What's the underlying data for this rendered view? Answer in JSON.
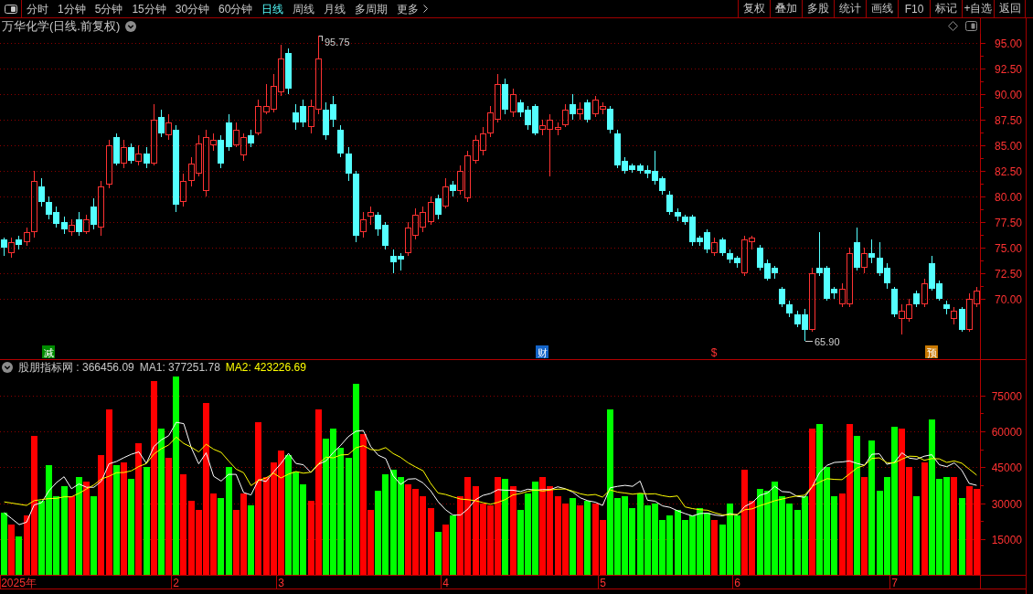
{
  "toolbar": {
    "periods": [
      {
        "label": "分时",
        "kind": "period",
        "selected": false
      },
      {
        "label": "1分钟",
        "kind": "period",
        "selected": false
      },
      {
        "label": "5分钟",
        "kind": "period",
        "selected": false
      },
      {
        "label": "15分钟",
        "kind": "period",
        "selected": false
      },
      {
        "label": "30分钟",
        "kind": "period",
        "selected": false
      },
      {
        "label": "60分钟",
        "kind": "period",
        "selected": false
      },
      {
        "label": "日线",
        "kind": "period",
        "selected": true
      },
      {
        "label": "周线",
        "kind": "period",
        "selected": false
      },
      {
        "label": "月线",
        "kind": "period",
        "selected": false
      },
      {
        "label": "多周期",
        "kind": "period",
        "selected": false
      },
      {
        "label": "更多",
        "kind": "more",
        "selected": false
      }
    ],
    "actions": [
      "复权",
      "叠加",
      "多股",
      "统计",
      "画线",
      "F10",
      "标记",
      "+自选",
      "返回"
    ]
  },
  "chart": {
    "readouts": [
      {
        "text": "股朋指标网 : 366456.09",
        "color": "#c8c8c8"
      },
      {
        "text": "MA1: 377251.78",
        "color": "#c8c8c8"
      },
      {
        "text": "MA2: 423226.69",
        "color": "#ffff00"
      }
    ],
    "event_markers": [
      {
        "kind": "badge",
        "color": "#008c00"
      },
      {
        "kind": "badge",
        "color": "#1464c8"
      },
      {
        "kind": "glyph",
        "color": "#ff3232"
      },
      {
        "kind": "badge",
        "color": "#c87800"
      }
    ],
    "chart_data": [
      {
        "type": "candlestick",
        "title": "万华化学(日线.前复权)",
        "categories": [
          null,
          null,
          null,
          null,
          null,
          null,
          "减",
          null,
          null,
          null,
          null,
          null,
          null,
          null,
          null,
          null,
          null,
          null,
          null,
          null,
          null,
          null,
          null,
          null,
          null,
          null,
          null,
          null,
          null,
          null,
          null,
          null,
          null,
          null,
          null,
          null,
          null,
          null,
          null,
          null,
          null,
          null,
          null,
          null,
          null,
          null,
          null,
          null,
          null,
          null,
          null,
          null,
          null,
          null,
          null,
          null,
          null,
          null,
          null,
          null,
          null,
          null,
          null,
          null,
          null,
          null,
          null,
          null,
          null,
          null,
          null,
          null,
          "财",
          null,
          null,
          null,
          null,
          null,
          null,
          null,
          null,
          null,
          null,
          null,
          null,
          null,
          null,
          null,
          null,
          null,
          null,
          null,
          null,
          null,
          null,
          "$",
          null,
          null,
          null,
          null,
          null,
          null,
          null,
          null,
          null,
          null,
          null,
          null,
          null,
          null,
          null,
          null,
          null,
          null,
          null,
          null,
          null,
          null,
          null,
          null,
          null,
          null,
          null,
          null,
          "预",
          null,
          null,
          null,
          null,
          null,
          null
        ],
        "ylim": [
          64.1,
          95.9
        ],
        "yticks": [
          {
            "value": 70,
            "label": "70.00"
          },
          {
            "value": 72.5,
            "label": "72.50"
          },
          {
            "value": 75,
            "label": "75.00"
          },
          {
            "value": 77.5,
            "label": "77.50"
          },
          {
            "value": 80,
            "label": "80.00"
          },
          {
            "value": 82.5,
            "label": "82.50"
          },
          {
            "value": 85,
            "label": "85.00"
          },
          {
            "value": 87.5,
            "label": "87.50"
          },
          {
            "value": 90,
            "label": "90.00"
          },
          {
            "value": 92.5,
            "label": "92.50"
          },
          {
            "value": 95,
            "label": "95.00"
          }
        ],
        "grid": true,
        "ohlc": [
          [
            75.8,
            76,
            74.2,
            75
          ],
          [
            74.5,
            76,
            74,
            75.5
          ],
          [
            75.8,
            76.2,
            74.8,
            75.3
          ],
          [
            75.5,
            77,
            75.2,
            76.5
          ],
          [
            76.5,
            82.5,
            76,
            81.5
          ],
          [
            81,
            81.8,
            79,
            79.5
          ],
          [
            79.5,
            80,
            77.8,
            78.2
          ],
          [
            78.5,
            79,
            77,
            77.3
          ],
          [
            77.5,
            78,
            76.3,
            76.8
          ],
          [
            76.5,
            77.8,
            76.2,
            77.2
          ],
          [
            77.8,
            78.5,
            76.2,
            76.5
          ],
          [
            76.5,
            78.2,
            76.3,
            77.8
          ],
          [
            79,
            79.8,
            76.8,
            77.2
          ],
          [
            77,
            81.5,
            76.2,
            81
          ],
          [
            81.2,
            85.5,
            80.8,
            85
          ],
          [
            85.8,
            86.2,
            83,
            83.2
          ],
          [
            83.2,
            85.5,
            82.8,
            84.8
          ],
          [
            84.8,
            85.2,
            83.2,
            83.5
          ],
          [
            83.4,
            85,
            83,
            84.2
          ],
          [
            84.2,
            84.8,
            82.8,
            83.2
          ],
          [
            83.2,
            89,
            83,
            87.5
          ],
          [
            87.8,
            88.5,
            85.8,
            86.2
          ],
          [
            86,
            88,
            85.5,
            87.2
          ],
          [
            86.5,
            87,
            78.5,
            79.2
          ],
          [
            79.5,
            82.2,
            79,
            81.5
          ],
          [
            81.5,
            83.8,
            81,
            83.2
          ],
          [
            82.2,
            86,
            82,
            85.2
          ],
          [
            80.5,
            86.5,
            80,
            85.8
          ],
          [
            85,
            86.2,
            84.5,
            85.5
          ],
          [
            85.5,
            86,
            82.8,
            83.2
          ],
          [
            87.2,
            88,
            84.5,
            84.8
          ],
          [
            85,
            87.2,
            84.8,
            86.5
          ],
          [
            84,
            86.2,
            83.5,
            85.8
          ],
          [
            86,
            86.5,
            84.8,
            85.2
          ],
          [
            86.2,
            89.5,
            86,
            88.8
          ],
          [
            88.2,
            91,
            88,
            88.8
          ],
          [
            88.5,
            92,
            88.2,
            90.8
          ],
          [
            90.2,
            94.8,
            89.8,
            93.5
          ],
          [
            94,
            94.5,
            90,
            90.5
          ],
          [
            88.2,
            89,
            86.5,
            87.2
          ],
          [
            88.8,
            89.5,
            86.8,
            87.2
          ],
          [
            86.8,
            89.5,
            86.2,
            88.8
          ],
          [
            88.5,
            95.75,
            88,
            93.5
          ],
          [
            88.5,
            89.2,
            85.5,
            86
          ],
          [
            89,
            89.8,
            86.8,
            87.5
          ],
          [
            86.5,
            87,
            83.8,
            84.2
          ],
          [
            84.2,
            84.8,
            81.5,
            82.2
          ],
          [
            82.2,
            82.5,
            75.5,
            76.2
          ],
          [
            76.5,
            78.5,
            76,
            77.8
          ],
          [
            78,
            79,
            77.2,
            78.5
          ],
          [
            78.2,
            78.5,
            76.2,
            76.8
          ],
          [
            77.2,
            77.5,
            74.8,
            75.2
          ],
          [
            74.2,
            74.8,
            72.5,
            73.6
          ],
          [
            74.2,
            74.5,
            72.8,
            73.8
          ],
          [
            74.5,
            77.5,
            74.2,
            77
          ],
          [
            76.2,
            78.8,
            75.8,
            78.2
          ],
          [
            77,
            79,
            76.5,
            78.5
          ],
          [
            77.5,
            80,
            77.2,
            79.5
          ],
          [
            79.8,
            80.2,
            77.8,
            78.2
          ],
          [
            79,
            81.8,
            78.8,
            81
          ],
          [
            81.2,
            81.5,
            80,
            80.5
          ],
          [
            80.5,
            83,
            80.2,
            82.5
          ],
          [
            79.8,
            84.5,
            79.5,
            84
          ],
          [
            83.5,
            86,
            83.2,
            85.5
          ],
          [
            84.5,
            86.8,
            84,
            86.2
          ],
          [
            86.2,
            88.8,
            85.8,
            88.2
          ],
          [
            87.5,
            92,
            87.2,
            91
          ],
          [
            91,
            91.5,
            88,
            88.5
          ],
          [
            88.2,
            90.5,
            87.8,
            90
          ],
          [
            89.2,
            89.5,
            87.8,
            88.2
          ],
          [
            88.5,
            88.8,
            86.5,
            87
          ],
          [
            88.8,
            89,
            86,
            86.2
          ],
          [
            86.5,
            87.5,
            86,
            87
          ],
          [
            86.5,
            88,
            82,
            87.5
          ],
          [
            86.5,
            87.2,
            86,
            86.8
          ],
          [
            87,
            89,
            86.8,
            88.5
          ],
          [
            89,
            90,
            87.5,
            88
          ],
          [
            88,
            89.2,
            87.5,
            88.6
          ],
          [
            89.2,
            89.5,
            87.2,
            87.5
          ],
          [
            88,
            89.8,
            87.8,
            89.5
          ],
          [
            88.5,
            89.2,
            88,
            88.8
          ],
          [
            88.6,
            88.8,
            86.2,
            86.5
          ],
          [
            86.2,
            86.5,
            82.8,
            83
          ],
          [
            83.5,
            83.8,
            82.2,
            82.5
          ],
          [
            83,
            83.2,
            82.3,
            82.6
          ],
          [
            83,
            83.2,
            82.2,
            82.5
          ],
          [
            82.6,
            83,
            81.8,
            82.2
          ],
          [
            82.5,
            84.5,
            81.2,
            81.5
          ],
          [
            81.8,
            82,
            80.2,
            80.5
          ],
          [
            80.2,
            80.5,
            78.2,
            78.5
          ],
          [
            78.5,
            78.8,
            77.6,
            78
          ],
          [
            78,
            78.2,
            77.2,
            77.5
          ],
          [
            78,
            78.2,
            75.2,
            75.5
          ],
          [
            76,
            76.2,
            75.2,
            75.5
          ],
          [
            76.5,
            76.8,
            74.5,
            74.8
          ],
          [
            74.5,
            76,
            74.2,
            75.5
          ],
          [
            75.8,
            76,
            74.2,
            74.5
          ],
          [
            74.5,
            74.8,
            73.5,
            73.8
          ],
          [
            74,
            74.2,
            73,
            73.5
          ],
          [
            72.5,
            76.2,
            72.2,
            75.8
          ],
          [
            75.5,
            76.2,
            74.8,
            76
          ],
          [
            75,
            75.3,
            72.8,
            73
          ],
          [
            73.5,
            73.8,
            71.8,
            72
          ],
          [
            73,
            73.2,
            72,
            72.5
          ],
          [
            71,
            71.2,
            69.2,
            69.5
          ],
          [
            69.5,
            69.8,
            68.2,
            68.6
          ],
          [
            68.5,
            68.8,
            67.2,
            67.5
          ],
          [
            68.5,
            69,
            65.9,
            67
          ],
          [
            67,
            73,
            66.8,
            72.5
          ],
          [
            73,
            76.5,
            72.2,
            72.5
          ],
          [
            73,
            73.2,
            69.8,
            70
          ],
          [
            71,
            71.2,
            70,
            70.5
          ],
          [
            69.5,
            71.5,
            69.2,
            71
          ],
          [
            69.5,
            75,
            69.2,
            74.5
          ],
          [
            75.5,
            77,
            72.8,
            73
          ],
          [
            73,
            75,
            72.5,
            74.5
          ],
          [
            74.5,
            75.8,
            73.5,
            74
          ],
          [
            74,
            75.5,
            72.2,
            72.5
          ],
          [
            73,
            73.5,
            71,
            71.5
          ],
          [
            71,
            71.2,
            68.2,
            68.5
          ],
          [
            68,
            69.5,
            66.5,
            68.8
          ],
          [
            68,
            70,
            67.8,
            69.5
          ],
          [
            70.5,
            70.8,
            69.2,
            69.5
          ],
          [
            69.5,
            72,
            69.2,
            71.5
          ],
          [
            73.5,
            74.2,
            70.8,
            71
          ],
          [
            71.5,
            71.8,
            69.8,
            70
          ],
          [
            69.5,
            69.8,
            68.5,
            69
          ],
          [
            68,
            69.2,
            67.5,
            68.8
          ],
          [
            69,
            69.2,
            66.8,
            67
          ],
          [
            67,
            70.5,
            66.8,
            70
          ],
          [
            69.5,
            71.2,
            69.2,
            70.8
          ]
        ],
        "annotations": [
          "95.75",
          "65.90"
        ]
      },
      {
        "type": "bar",
        "categories": [
          null,
          null,
          "2025年",
          null,
          null,
          null,
          null,
          null,
          null,
          null,
          null,
          null,
          null,
          null,
          null,
          null,
          null,
          null,
          null,
          null,
          null,
          null,
          null,
          "2",
          null,
          null,
          null,
          null,
          null,
          null,
          null,
          null,
          null,
          null,
          null,
          null,
          null,
          "3",
          null,
          null,
          null,
          null,
          null,
          null,
          null,
          null,
          null,
          null,
          null,
          null,
          null,
          null,
          null,
          null,
          null,
          null,
          null,
          null,
          null,
          "4",
          null,
          null,
          null,
          null,
          null,
          null,
          null,
          null,
          null,
          null,
          null,
          null,
          null,
          null,
          null,
          null,
          null,
          null,
          null,
          null,
          "5",
          null,
          null,
          null,
          null,
          null,
          null,
          null,
          null,
          null,
          null,
          null,
          null,
          null,
          null,
          null,
          null,
          null,
          "6",
          null,
          null,
          null,
          null,
          null,
          null,
          null,
          null,
          null,
          null,
          null,
          null,
          null,
          null,
          null,
          null,
          null,
          null,
          null,
          null,
          "7",
          null,
          null,
          null,
          null,
          null,
          null,
          null,
          null,
          null,
          null,
          null
        ],
        "ylim": [
          0,
          90000
        ],
        "yticks": [
          15000,
          30000,
          45000,
          60000,
          75000
        ],
        "grid": true,
        "series": [
          {
            "type": "bar",
            "values": [
              26000,
              21000,
              16000,
              25000,
              58000,
              31000,
              46000,
              33000,
              37000,
              33000,
              41000,
              39000,
              33000,
              50000,
              69000,
              46000,
              47000,
              40000,
              55000,
              45000,
              81000,
              61000,
              49000,
              83000,
              42000,
              31000,
              27000,
              72000,
              34000,
              32000,
              45000,
              27000,
              34000,
              29000,
              64000,
              41000,
              47000,
              52000,
              50000,
              43000,
              38000,
              31000,
              69000,
              57000,
              61000,
              53000,
              49000,
              80000,
              59000,
              27000,
              35000,
              42000,
              44000,
              41000,
              38000,
              36000,
              33000,
              28000,
              18000,
              21000,
              25000,
              33000,
              41000,
              37000,
              30000,
              29000,
              41000,
              40000,
              37000,
              27000,
              34000,
              39000,
              41000,
              37000,
              33000,
              30000,
              32000,
              29000,
              31000,
              30000,
              23000,
              69000,
              32000,
              33000,
              28000,
              34000,
              29000,
              30000,
              23000,
              25000,
              27000,
              23000,
              25000,
              28000,
              26000,
              23000,
              21000,
              30000,
              25000,
              44000,
              31000,
              36000,
              35000,
              39000,
              33000,
              30000,
              27000,
              33000,
              61000,
              63000,
              45000,
              33000,
              34000,
              63000,
              58000,
              41000,
              56000,
              35000,
              41000,
              62000,
              61000,
              45000,
              33000,
              47000,
              65000,
              40000,
              41000,
              41000,
              32000,
              37000,
              36000
            ],
            "colors": [
              "#00ff00",
              "#ff0000",
              "#00ff00",
              "#ff0000",
              "#ff0000",
              "#00ff00",
              "#00ff00",
              "#00ff00",
              "#00ff00",
              "#ff0000",
              "#00ff00",
              "#ff0000",
              "#00ff00",
              "#ff0000",
              "#ff0000",
              "#00ff00",
              "#ff0000",
              "#00ff00",
              "#ff0000",
              "#00ff00",
              "#ff0000",
              "#00ff00",
              "#ff0000",
              "#00ff00",
              "#ff0000",
              "#ff0000",
              "#ff0000",
              "#ff0000",
              "#ff0000",
              "#00ff00",
              "#00ff00",
              "#ff0000",
              "#ff0000",
              "#00ff00",
              "#ff0000",
              "#ff0000",
              "#ff0000",
              "#ff0000",
              "#00ff00",
              "#00ff00",
              "#00ff00",
              "#ff0000",
              "#ff0000",
              "#00ff00",
              "#00ff00",
              "#00ff00",
              "#00ff00",
              "#00ff00",
              "#ff0000",
              "#ff0000",
              "#00ff00",
              "#00ff00",
              "#00ff00",
              "#00ff00",
              "#ff0000",
              "#ff0000",
              "#ff0000",
              "#ff0000",
              "#00ff00",
              "#ff0000",
              "#00ff00",
              "#ff0000",
              "#ff0000",
              "#ff0000",
              "#ff0000",
              "#ff0000",
              "#ff0000",
              "#00ff00",
              "#ff0000",
              "#00ff00",
              "#00ff00",
              "#00ff00",
              "#ff0000",
              "#ff0000",
              "#ff0000",
              "#ff0000",
              "#00ff00",
              "#ff0000",
              "#00ff00",
              "#ff0000",
              "#ff0000",
              "#00ff00",
              "#00ff00",
              "#00ff00",
              "#00ff00",
              "#00ff00",
              "#00ff00",
              "#00ff00",
              "#00ff00",
              "#00ff00",
              "#00ff00",
              "#00ff00",
              "#00ff00",
              "#00ff00",
              "#00ff00",
              "#ff0000",
              "#00ff00",
              "#00ff00",
              "#00ff00",
              "#ff0000",
              "#ff0000",
              "#00ff00",
              "#00ff00",
              "#00ff00",
              "#00ff00",
              "#00ff00",
              "#00ff00",
              "#00ff00",
              "#ff0000",
              "#00ff00",
              "#00ff00",
              "#00ff00",
              "#ff0000",
              "#ff0000",
              "#00ff00",
              "#ff0000",
              "#00ff00",
              "#00ff00",
              "#00ff00",
              "#00ff00",
              "#ff0000",
              "#ff0000",
              "#00ff00",
              "#ff0000",
              "#00ff00",
              "#00ff00",
              "#00ff00",
              "#ff0000",
              "#00ff00",
              "#ff0000",
              "#ff0000"
            ]
          },
          {
            "type": "line",
            "color": "#ffffff",
            "values": [
              26000,
              23500,
              21000,
              22000,
              29200,
              30200,
              35200,
              38600,
              41000,
              36000,
              38000,
              36600,
              36600,
              39200,
              46400,
              47400,
              49000,
              50400,
              51400,
              46600,
              53600,
              56400,
              58200,
              63800,
              63200,
              53200,
              46400,
              51000,
              41200,
              39200,
              42000,
              42000,
              34400,
              33400,
              39800,
              39000,
              43000,
              46600,
              50800,
              46600,
              46000,
              42800,
              46200,
              47600,
              51200,
              54200,
              57800,
              60000,
              60400,
              53600,
              50000,
              48600,
              41400,
              37800,
              40000,
              40200,
              38400,
              35200,
              30600,
              27200,
              25000,
              25000,
              27600,
              31400,
              33200,
              34000,
              35600,
              35400,
              35400,
              34800,
              35800,
              35400,
              35600,
              35600,
              36800,
              36000,
              34600,
              32200,
              31000,
              30400,
              29000,
              36400,
              37000,
              37400,
              37000,
              39200,
              31200,
              30800,
              28800,
              28200,
              26800,
              25600,
              24600,
              25600,
              25800,
              25000,
              24600,
              25600,
              25000,
              28600,
              30200,
              33200,
              34200,
              37000,
              34800,
              34600,
              32800,
              32400,
              36800,
              42800,
              45800,
              47000,
              47200,
              47600,
              46600,
              45800,
              50400,
              50600,
              46200,
              47000,
              51000,
              48800,
              48400,
              49600,
              50200,
              46000,
              45200,
              46800,
              43800,
              38200,
              37400
            ]
          },
          {
            "type": "line",
            "color": "#ffff00",
            "values": [
              30500,
              30000,
              29500,
              29000,
              31000,
              31500,
              31900,
              32000,
              32600,
              32600,
              34100,
              35900,
              37600,
              40100,
              41200,
              42700,
              42800,
              43500,
              45300,
              46500,
              50500,
              52700,
              54300,
              57600,
              54900,
              53400,
              51400,
              54600,
              52500,
              51200,
              47600,
              44200,
              42700,
              37300,
              39500,
              40500,
              42500,
              40500,
              42100,
              43200,
              42500,
              42900,
              46400,
              49200,
              48900,
              50100,
              50300,
              53100,
              54000,
              52400,
              52100,
              53200,
              50700,
              49100,
              46800,
              45100,
              43500,
              38300,
              34200,
              33600,
              32600,
              31700,
              31400,
              31000,
              30200,
              29500,
              30300,
              31500,
              33400,
              34000,
              34900,
              35500,
              35000,
              35500,
              35800,
              35900,
              35000,
              33900,
              33300,
              33600,
              32500,
              35500,
              34600,
              34200,
              33700,
              34100,
              33800,
              33900,
              33100,
              32600,
              33000,
              28400,
              27700,
              27200,
              27000,
              25900,
              25100,
              25100,
              25300,
              27200,
              27600,
              28900,
              29900,
              31000,
              31700,
              32400,
              33000,
              33300,
              36900,
              38800,
              40200,
              39900,
              39800,
              42200,
              44700,
              45800,
              48700,
              48900,
              46900,
              46800,
              48400,
              49600,
              49500,
              47900,
              48600,
              48500,
              47000,
              47600,
              46700,
              44200,
              41700
            ]
          }
        ]
      }
    ]
  }
}
